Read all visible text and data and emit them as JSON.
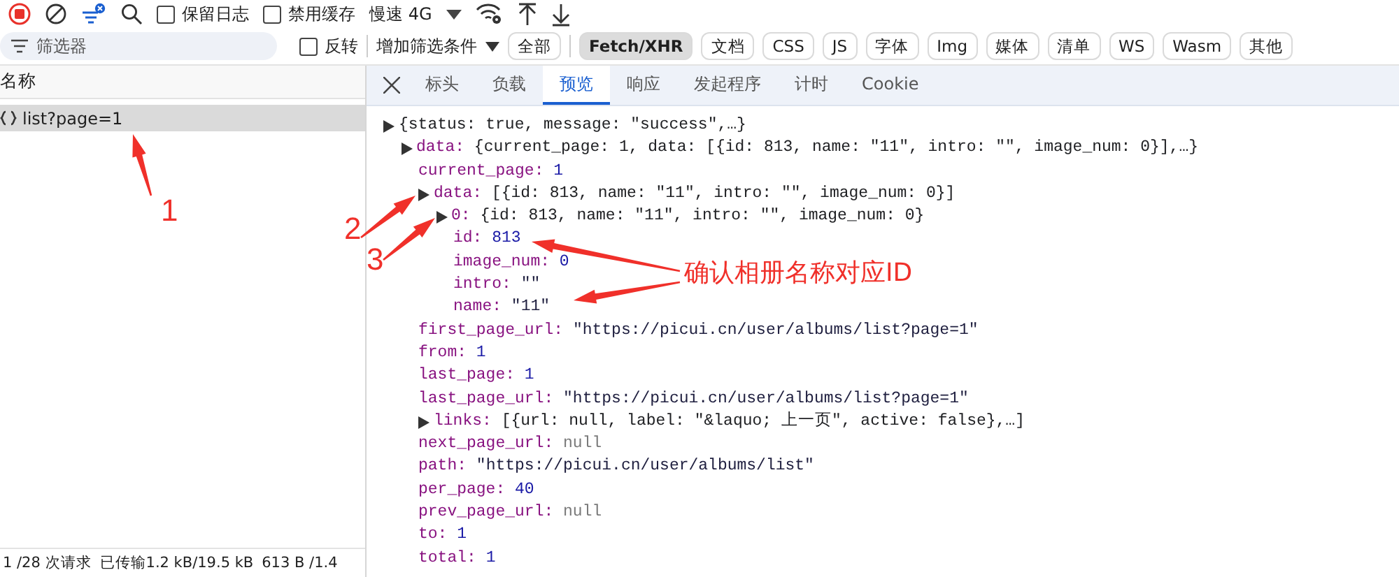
{
  "toolbar": {
    "preserve_log": {
      "label": "保留日志",
      "checked": false
    },
    "disable_cache": {
      "label": "禁用缓存",
      "checked": false
    },
    "throttle": "慢速 4G"
  },
  "filter_bar": {
    "placeholder": "筛选器",
    "invert": {
      "label": "反转",
      "checked": false
    },
    "more_filters": "增加筛选条件",
    "types": [
      {
        "label": "全部",
        "selected": false
      },
      {
        "label": "Fetch/XHR",
        "selected": true
      },
      {
        "label": "文档",
        "selected": false
      },
      {
        "label": "CSS",
        "selected": false
      },
      {
        "label": "JS",
        "selected": false
      },
      {
        "label": "字体",
        "selected": false
      },
      {
        "label": "Img",
        "selected": false
      },
      {
        "label": "媒体",
        "selected": false
      },
      {
        "label": "清单",
        "selected": false
      },
      {
        "label": "WS",
        "selected": false
      },
      {
        "label": "Wasm",
        "selected": false
      },
      {
        "label": "其他",
        "selected": false
      }
    ]
  },
  "requests": {
    "column": "名称",
    "rows": [
      {
        "name": "list?page=1",
        "selected": true
      }
    ]
  },
  "status_bar": [
    "1 /28 次请求",
    "已传输1.2 kB/19.5 kB",
    "613 B /1.4"
  ],
  "detail_tabs": [
    {
      "label": "标头",
      "selected": false
    },
    {
      "label": "负载",
      "selected": false
    },
    {
      "label": "预览",
      "selected": true
    },
    {
      "label": "响应",
      "selected": false
    },
    {
      "label": "发起程序",
      "selected": false
    },
    {
      "label": "计时",
      "selected": false
    },
    {
      "label": "Cookie",
      "selected": false
    }
  ],
  "preview": [
    {
      "value": "{status: true, message: \"success\",…}",
      "kind": "object",
      "children": [
        {
          "key": "data:",
          "value": "{current_page: 1, data: [{id: 813, name: \"11\", intro: \"\", image_num: 0}],…}",
          "kind": "object",
          "children": [
            {
              "key": "current_page:",
              "value": "1",
              "kind": "number"
            },
            {
              "key": "data:",
              "value": "[{id: 813, name: \"11\", intro: \"\", image_num: 0}]",
              "kind": "object",
              "children": [
                {
                  "key": "0:",
                  "value": "{id: 813, name: \"11\", intro: \"\", image_num: 0}",
                  "kind": "object",
                  "children": [
                    {
                      "key": "id:",
                      "value": "813",
                      "kind": "number"
                    },
                    {
                      "key": "image_num:",
                      "value": "0",
                      "kind": "number"
                    },
                    {
                      "key": "intro:",
                      "value": "\"\"",
                      "kind": "string"
                    },
                    {
                      "key": "name:",
                      "value": "\"11\"",
                      "kind": "string"
                    }
                  ]
                }
              ]
            },
            {
              "key": "first_page_url:",
              "value": "\"https://picui.cn/user/albums/list?page=1\"",
              "kind": "string"
            },
            {
              "key": "from:",
              "value": "1",
              "kind": "number"
            },
            {
              "key": "last_page:",
              "value": "1",
              "kind": "number"
            },
            {
              "key": "last_page_url:",
              "value": "\"https://picui.cn/user/albums/list?page=1\"",
              "kind": "string"
            },
            {
              "key": "links:",
              "value": "[{url: null, label: \"&laquo; 上一页\", active: false},…]",
              "kind": "object"
            },
            {
              "key": "next_page_url:",
              "value": "null",
              "kind": "null"
            },
            {
              "key": "path:",
              "value": "\"https://picui.cn/user/albums/list\"",
              "kind": "string"
            },
            {
              "key": "per_page:",
              "value": "40",
              "kind": "number"
            },
            {
              "key": "prev_page_url:",
              "value": "null",
              "kind": "null"
            },
            {
              "key": "to:",
              "value": "1",
              "kind": "number"
            },
            {
              "key": "total:",
              "value": "1",
              "kind": "number"
            }
          ]
        }
      ]
    }
  ],
  "annotations": {
    "markers": [
      "1",
      "2",
      "3"
    ],
    "callout": "确认相册名称对应ID"
  }
}
